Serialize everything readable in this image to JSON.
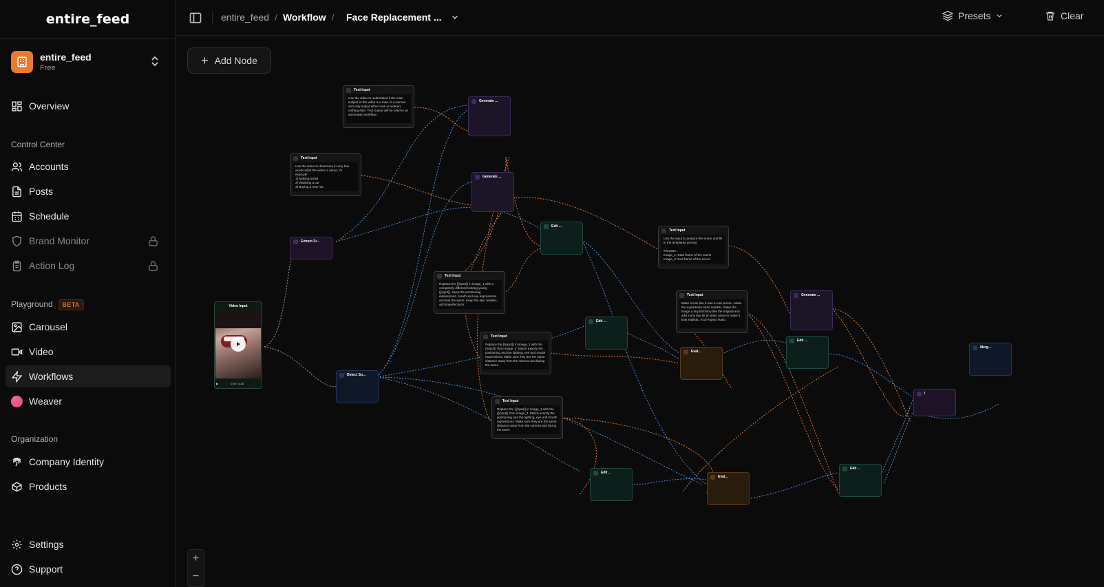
{
  "app": {
    "brand": "entire_feed"
  },
  "workspace": {
    "name": "entire_feed",
    "plan": "Free"
  },
  "nav": {
    "overview": "Overview",
    "section_control": "Control Center",
    "accounts": "Accounts",
    "posts": "Posts",
    "schedule": "Schedule",
    "brand_monitor": "Brand Monitor",
    "action_log": "Action Log",
    "section_playground": "Playground",
    "beta": "BETA",
    "carousel": "Carousel",
    "video": "Video",
    "workflows": "Workflows",
    "weaver": "Weaver",
    "section_org": "Organization",
    "company_identity": "Company Identity",
    "products": "Products",
    "settings": "Settings",
    "support": "Support"
  },
  "topbar": {
    "crumb_1": "entire_feed",
    "crumb_2": "Workflow",
    "flow_name": "Face Replacement ...",
    "presets": "Presets",
    "clear": "Clear"
  },
  "canvas": {
    "add_node": "Add Node",
    "zoom_in": "+",
    "zoom_out": "−"
  },
  "nodes": {
    "t1_title": "Text Input",
    "t1_body": "Use the video to understand if the main subject in the video is a man or a woman and only output either man or woman, nothing else. Your output will be used in an automated workflow.",
    "t2_title": "Text Input",
    "t2_body": "Use the video to determine in very few words what the video is about, for example:\n1) Making bread\n2) Washing a car\n3) Buying a new hat",
    "g1_title": "Generate ...",
    "g2_title": "Generate ...",
    "extract_title": "Extract Fr...",
    "video_title": "Video Input",
    "video_time": "0:00 / 0:35",
    "detect_title": "Detect So...",
    "t3_title": "Text Input",
    "t3_body": "Replace the {{input}} in image_1 with a completely different-looking young {{input}}. Keep the positioning, expressions, mouth and eye expressions and text the same. Keep the skin realistic, add imperfections",
    "edit1_title": "Edit ...",
    "t4_title": "Text Input",
    "t4_body": "Use the input to analyze the scene and fill in the templated prompt.\n\n##Inputs:\nImage_1: Start frame of the scene\nImage_2: End frame of the scene",
    "t5_title": "Text Input",
    "t5_body": "Make it look like it was a real person. Make the expression more realistic. Make the image a tiny bit blurry like the original and add a tiny tiny bit of video noise to make it look realistic. 9:16 Aspect Ratio.",
    "g3_title": "Generate ...",
    "edit2_title": "Edit ...",
    "t6_title": "Text Input",
    "t6_body": "Replace the {{input}} in image_1 with the {{input}} from image_2. Match exactly the positioning and the lighting, eye and mouth expressions. Make sure they are the same distance away from the camera and facing the same",
    "eval1_title": "Eval...",
    "edit3_title": "Edit ...",
    "t7_title": "Text Input",
    "t7_body": "Replace the {{input}} in image_1 with the {{input}} from image_2. Match exactly the positioning and the lighting, eye and mouth expressions. Make sure they are the same distance away from the camera and facing the same",
    "edit4_title": "Edit ...",
    "eval2_title": "Eval...",
    "edit5_title": "Edit ...",
    "i2v_title": "I",
    "merge_title": "Merg..."
  },
  "colors": {
    "accent": "#e97a2e",
    "edge_blue": "#4f8fe0",
    "edge_orange": "#e07a3a"
  }
}
